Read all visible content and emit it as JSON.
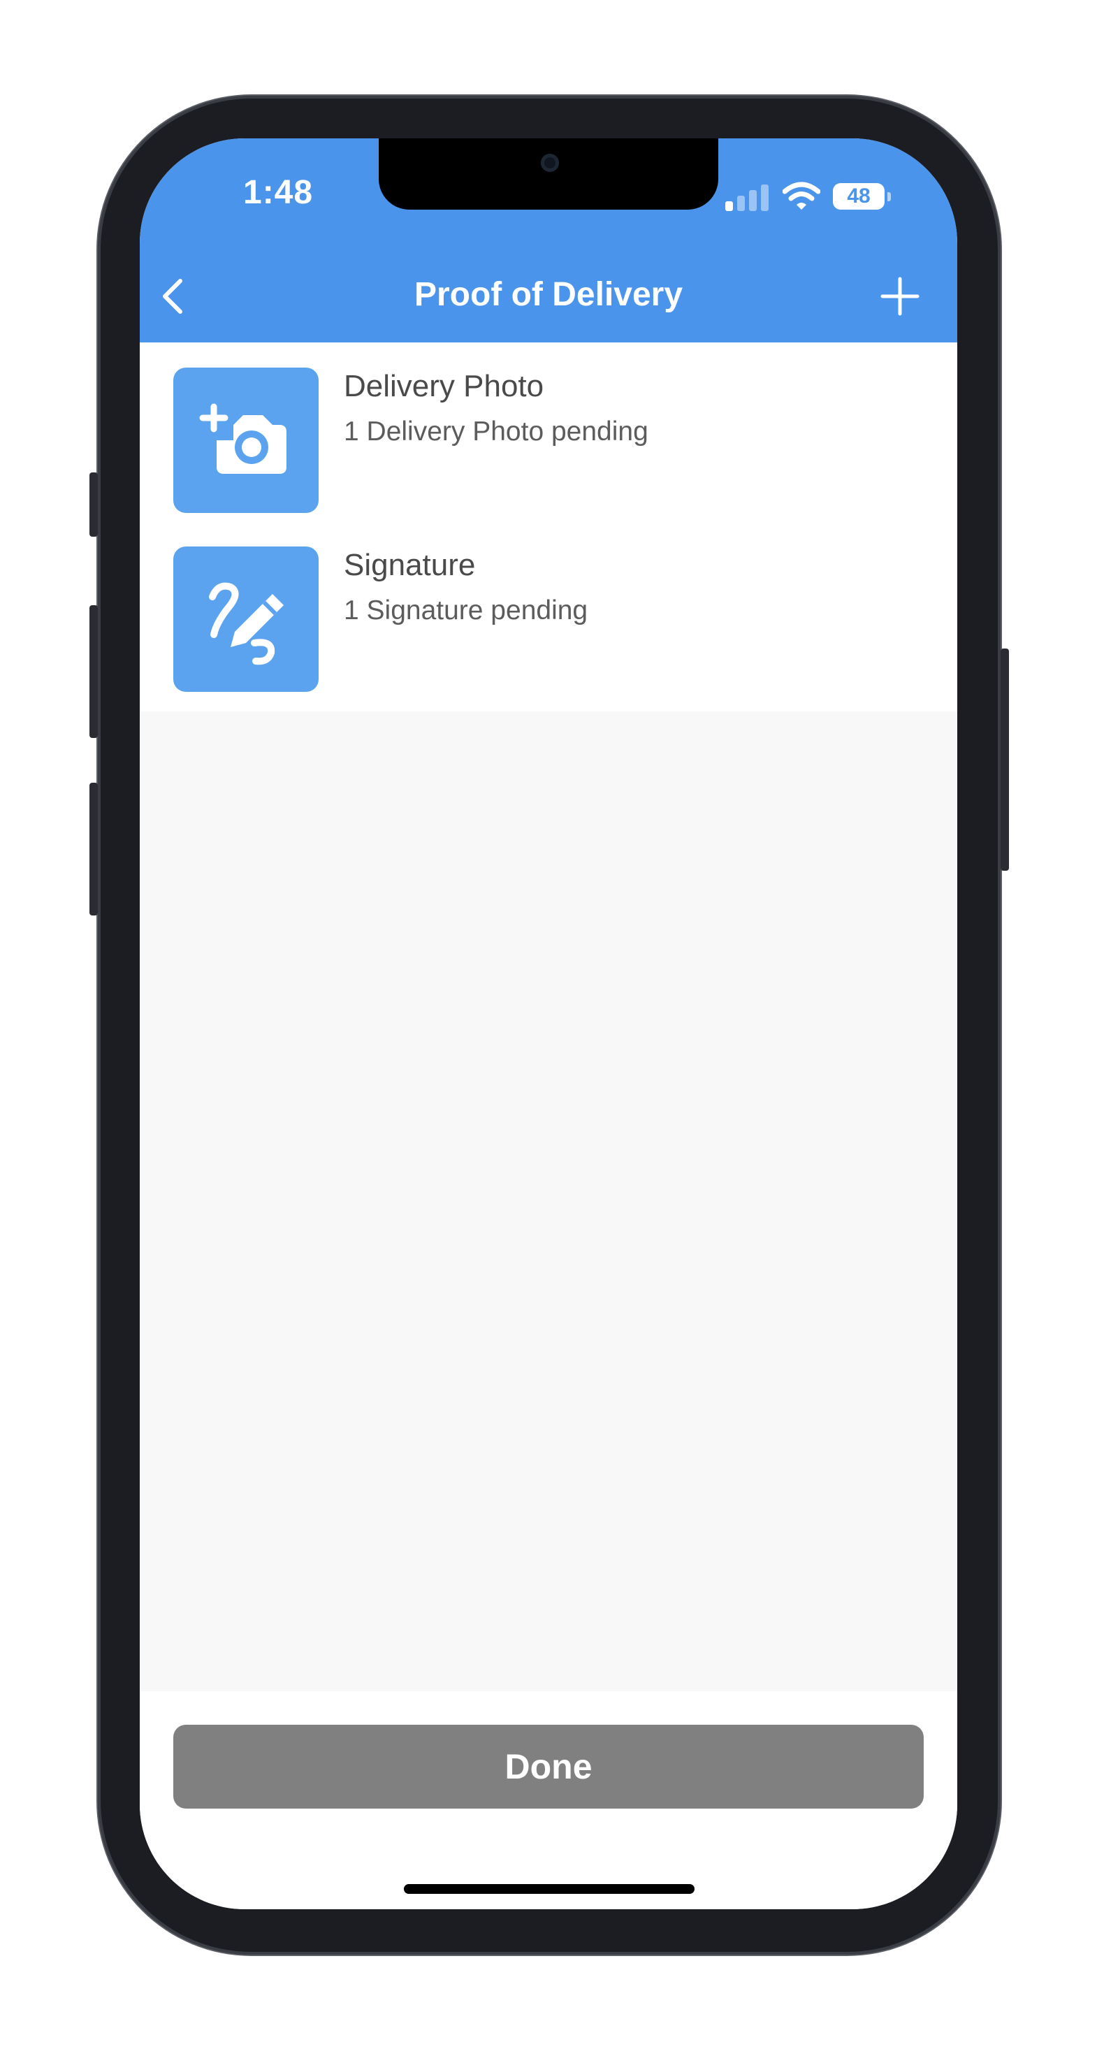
{
  "status_bar": {
    "time": "1:48",
    "battery": "48",
    "signal_icon": "cellular-signal-icon",
    "wifi_icon": "wifi-icon"
  },
  "nav": {
    "title": "Proof of Delivery",
    "back_icon": "chevron-left-icon",
    "add_icon": "plus-icon"
  },
  "items": [
    {
      "title": "Delivery Photo",
      "subtitle": "1 Delivery Photo pending",
      "icon": "add-camera-icon"
    },
    {
      "title": "Signature",
      "subtitle": "1 Signature pending",
      "icon": "signature-pencil-icon"
    }
  ],
  "footer": {
    "done_label": "Done"
  },
  "colors": {
    "accent": "#4a94eb",
    "tile": "#5ba3ef",
    "done_button": "#808080",
    "empty_background": "#f8f8f8"
  }
}
